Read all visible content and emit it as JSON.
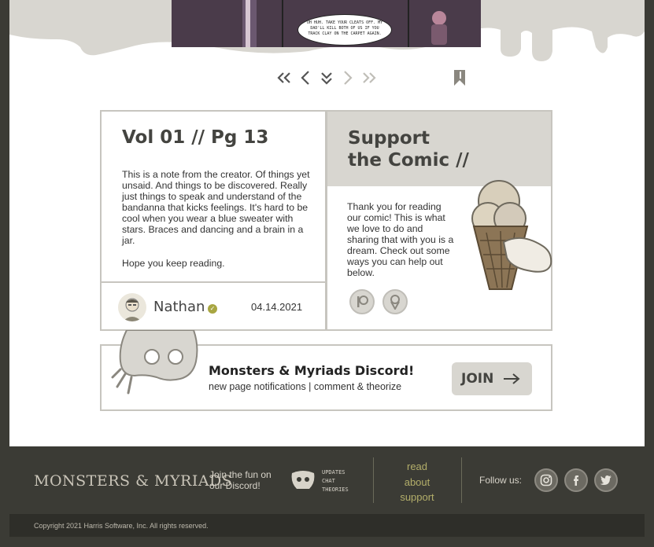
{
  "comic": {
    "speech": "UH HUH. TAKE YOUR CLEATS OFF. MY DAD'LL KILL BOTH OF US IF YOU TRACK CLAY ON THE CARPET AGAIN."
  },
  "nav": {
    "first": "first-page",
    "prev": "previous-page",
    "jump": "jump-to-comments",
    "next": "next-page",
    "last": "last-page",
    "bookmark": "bookmark"
  },
  "note": {
    "title": "Vol 01 // Pg 13",
    "body": "This is a note from the creator. Of things yet unsaid. And things to be discovered. Really just things to speak and understand of the bandanna that kicks feelings. It's hard to be cool when you wear a blue sweater with stars. Braces and dancing and a brain in a jar.",
    "closing": "Hope you keep reading.",
    "author": "Nathan",
    "date": "04.14.2021"
  },
  "support": {
    "title_line1": "Support",
    "title_line2": "the Comic //",
    "body": "Thank you for reading our comic! This is what we love to do and sharing that with you is a dream. Check out some ways you can help out below.",
    "icons": [
      "patreon-icon",
      "icecream-icon"
    ]
  },
  "discord": {
    "title": "Monsters & Myriads Discord!",
    "subtitle": "new page notifications  |  comment & theorize",
    "join_label": "JOIN"
  },
  "footer": {
    "logo": "MONSTERS & MYRIADS",
    "join_fun": "Join the fun on our Discord!",
    "discord_tags": [
      "UPDATES",
      "CHAT",
      "THEORIES"
    ],
    "links": [
      "read",
      "about",
      "support"
    ],
    "follow": "Follow us:",
    "social": [
      "instagram-icon",
      "facebook-icon",
      "twitter-icon"
    ],
    "copyright": "Copyright 2021 Harris Software, Inc. All rights reserved."
  },
  "colors": {
    "accent": "#b3ae6a",
    "panel": "#d8d6d0",
    "footer": "#3b3b35",
    "border": "#c7c5bf"
  }
}
